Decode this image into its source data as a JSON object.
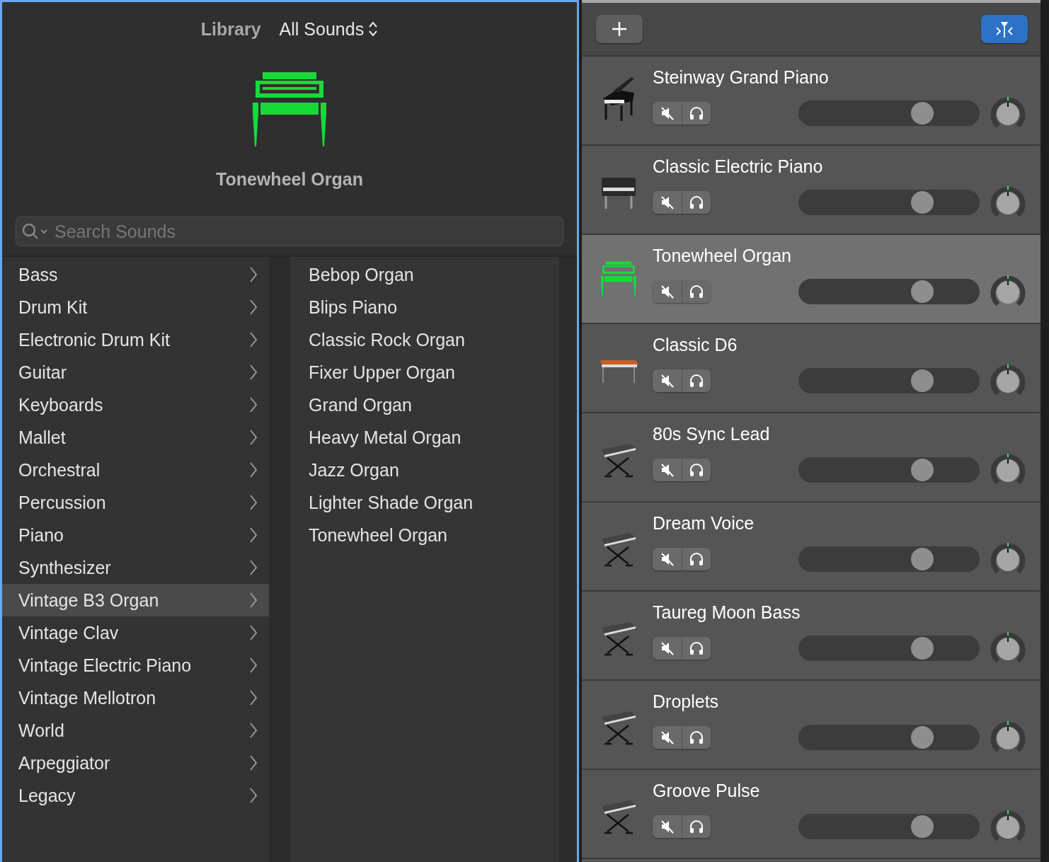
{
  "library": {
    "title": "Library",
    "filter": "All Sounds",
    "current_sound": "Tonewheel Organ",
    "search": {
      "placeholder": "Search Sounds"
    },
    "categories": [
      {
        "label": "Bass",
        "selected": false
      },
      {
        "label": "Drum Kit",
        "selected": false
      },
      {
        "label": "Electronic Drum Kit",
        "selected": false
      },
      {
        "label": "Guitar",
        "selected": false
      },
      {
        "label": "Keyboards",
        "selected": false
      },
      {
        "label": "Mallet",
        "selected": false
      },
      {
        "label": "Orchestral",
        "selected": false
      },
      {
        "label": "Percussion",
        "selected": false
      },
      {
        "label": "Piano",
        "selected": false
      },
      {
        "label": "Synthesizer",
        "selected": false
      },
      {
        "label": "Vintage B3 Organ",
        "selected": true
      },
      {
        "label": "Vintage Clav",
        "selected": false
      },
      {
        "label": "Vintage Electric Piano",
        "selected": false
      },
      {
        "label": "Vintage Mellotron",
        "selected": false
      },
      {
        "label": "World",
        "selected": false
      },
      {
        "label": "Arpeggiator",
        "selected": false
      },
      {
        "label": "Legacy",
        "selected": false
      }
    ],
    "sounds": [
      {
        "label": "Bebop Organ",
        "selected": false
      },
      {
        "label": "Blips Piano",
        "selected": false
      },
      {
        "label": "Classic Rock Organ",
        "selected": false
      },
      {
        "label": "Fixer Upper Organ",
        "selected": false
      },
      {
        "label": "Grand Organ",
        "selected": false
      },
      {
        "label": "Heavy Metal Organ",
        "selected": false
      },
      {
        "label": "Jazz Organ",
        "selected": false
      },
      {
        "label": "Lighter Shade Organ",
        "selected": false
      },
      {
        "label": "Tonewheel Organ",
        "selected": false
      }
    ]
  },
  "tracks": [
    {
      "name": "Steinway Grand Piano",
      "kind": "grand-piano",
      "selected": false,
      "muted": false,
      "solo": false,
      "level": 0.71
    },
    {
      "name": "Classic Electric Piano",
      "kind": "electric-piano",
      "selected": false,
      "muted": false,
      "solo": false,
      "level": 0.71
    },
    {
      "name": "Tonewheel Organ",
      "kind": "organ",
      "selected": true,
      "muted": false,
      "solo": false,
      "level": 0.71
    },
    {
      "name": "Classic D6",
      "kind": "keyboard-table",
      "selected": false,
      "muted": false,
      "solo": false,
      "level": 0.71
    },
    {
      "name": "80s Sync Lead",
      "kind": "keyboard-stand",
      "selected": false,
      "muted": false,
      "solo": false,
      "level": 0.71
    },
    {
      "name": "Dream Voice",
      "kind": "keyboard-stand",
      "selected": false,
      "muted": false,
      "solo": false,
      "level": 0.71
    },
    {
      "name": "Taureg Moon Bass",
      "kind": "keyboard-stand",
      "selected": false,
      "muted": false,
      "solo": false,
      "level": 0.71
    },
    {
      "name": "Droplets",
      "kind": "keyboard-stand",
      "selected": false,
      "muted": false,
      "solo": false,
      "level": 0.71
    },
    {
      "name": "Groove Pulse",
      "kind": "keyboard-stand",
      "selected": false,
      "muted": false,
      "solo": false,
      "level": 0.71
    }
  ]
}
